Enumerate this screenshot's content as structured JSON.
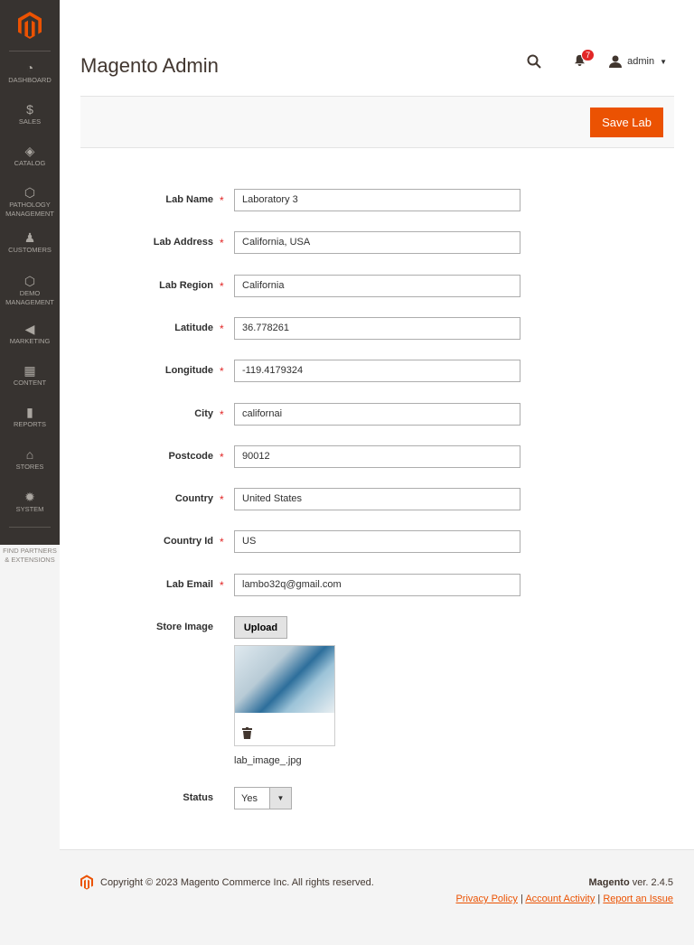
{
  "sidebar": {
    "items": [
      {
        "label": "Dashboard",
        "icon": "dashboard-icon"
      },
      {
        "label": "$",
        "icon": "dollar-icon",
        "text": "Sales"
      },
      {
        "label": "Catalog",
        "icon": "box-icon"
      },
      {
        "label": "Pathology Management",
        "icon": "hexagon-icon"
      },
      {
        "label": "Customers",
        "icon": "person-icon"
      },
      {
        "label": "Demo Management",
        "icon": "hexagon-icon"
      },
      {
        "label": "Marketing",
        "icon": "megaphone-icon"
      },
      {
        "label": "Content",
        "icon": "layout-icon"
      },
      {
        "label": "Reports",
        "icon": "bar-chart-icon"
      },
      {
        "label": "Stores",
        "icon": "store-icon"
      },
      {
        "label": "System",
        "icon": "gear-icon"
      }
    ],
    "partners": "Find Partners & Extensions"
  },
  "header": {
    "title": "Magento Admin",
    "notifications": "7",
    "user": "admin"
  },
  "actions": {
    "save": "Save Lab"
  },
  "form": {
    "fields": [
      {
        "label": "Lab Name",
        "value": "Laboratory 3"
      },
      {
        "label": "Lab Address",
        "value": "California, USA"
      },
      {
        "label": "Lab Region",
        "value": "California"
      },
      {
        "label": "Latitude",
        "value": "36.778261"
      },
      {
        "label": "Longitude",
        "value": "-119.4179324"
      },
      {
        "label": "City",
        "value": "californai"
      },
      {
        "label": "Postcode",
        "value": "90012"
      },
      {
        "label": "Country",
        "value": "United States"
      },
      {
        "label": "Country Id",
        "value": "US"
      },
      {
        "label": "Lab Email",
        "value": "lambo32q@gmail.com"
      }
    ],
    "required_mark": "*",
    "image_label": "Store Image",
    "upload": "Upload",
    "file_name": "lab_image_.jpg",
    "status_label": "Status",
    "status_value": "Yes"
  },
  "footer": {
    "copyright": "Copyright © 2023 Magento Commerce Inc. All rights reserved.",
    "brand": "Magento",
    "version": " ver. 2.4.5",
    "links": [
      "Privacy Policy",
      "Account Activity",
      "Report an Issue"
    ],
    "sep": "|"
  }
}
